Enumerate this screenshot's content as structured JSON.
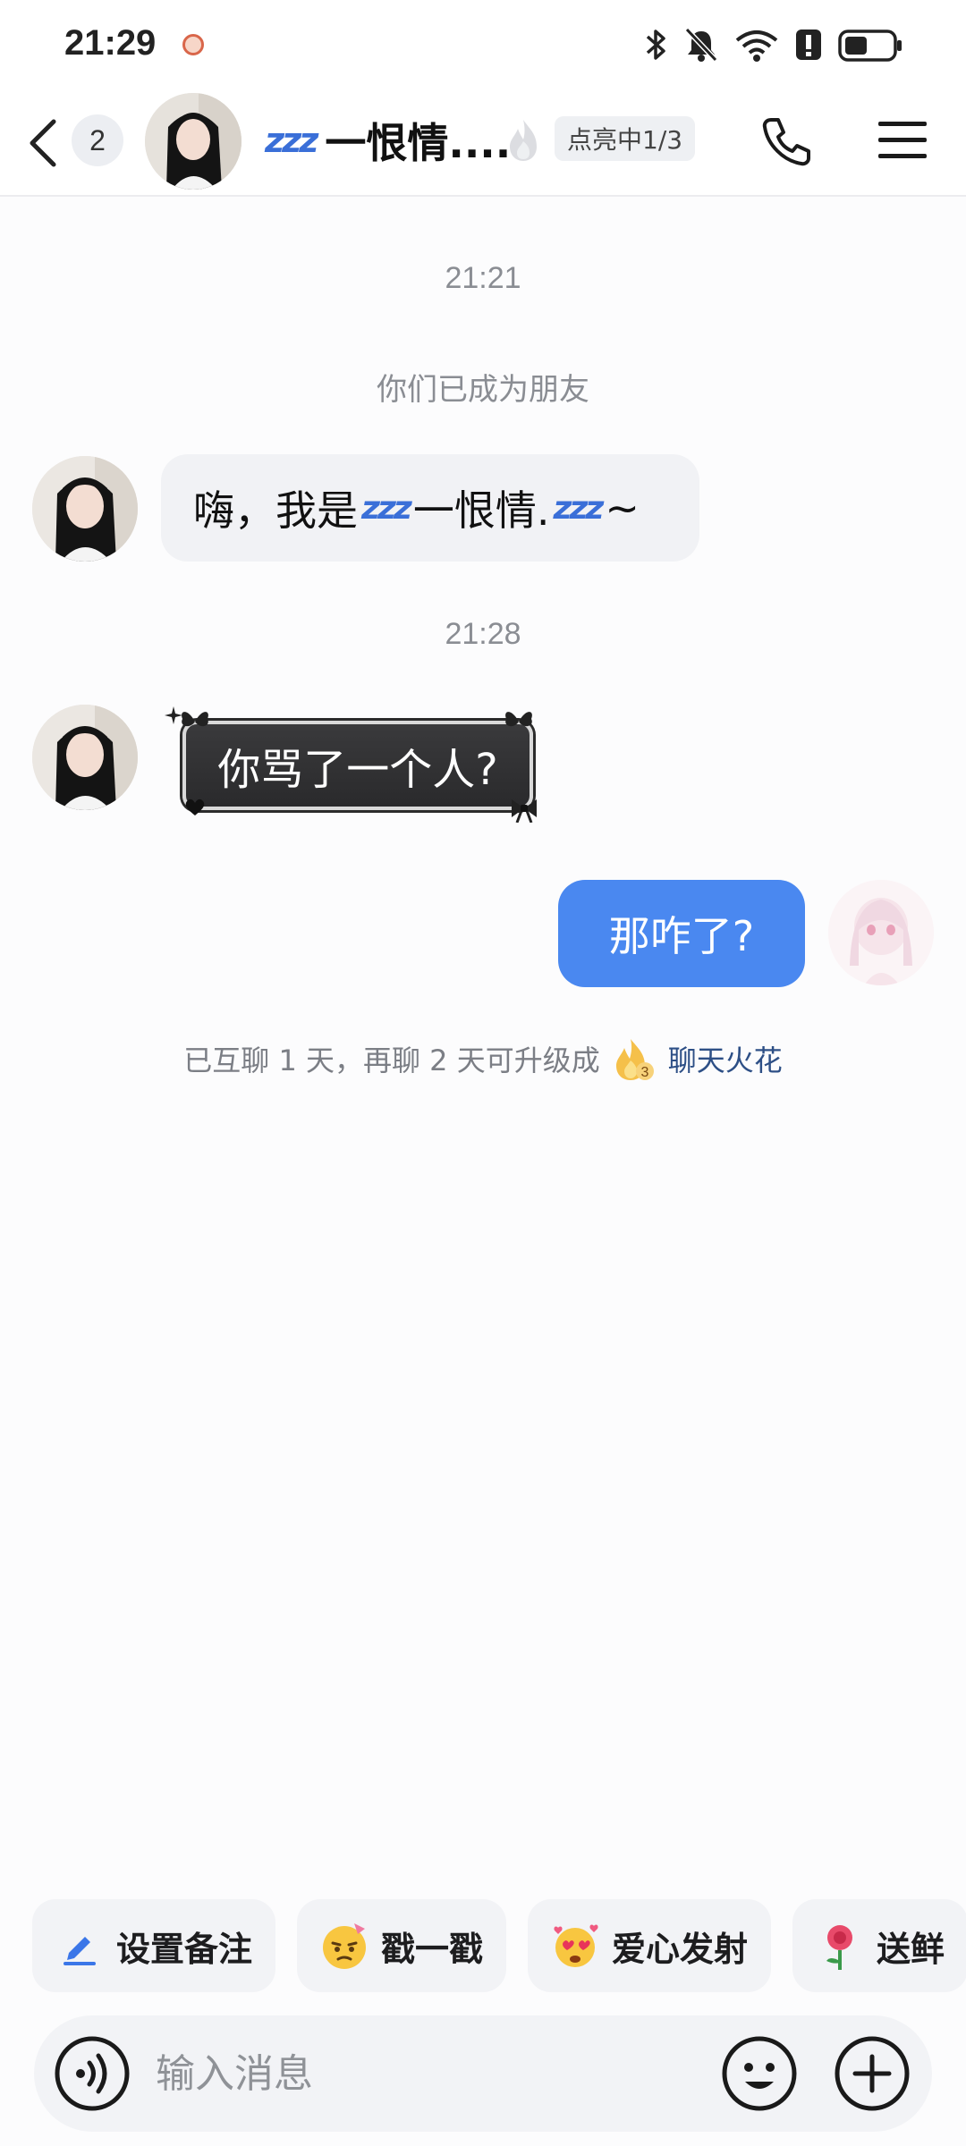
{
  "status_bar": {
    "time": "21:29",
    "icons": [
      "bluetooth-icon",
      "bell-muted-icon",
      "wifi-icon",
      "alert-icon",
      "battery-icon"
    ]
  },
  "header": {
    "unread_count": "2",
    "title_decoration": "zzz",
    "title": "一恨情....",
    "light_status": "点亮中1/3",
    "icons": [
      "back-arrow-icon",
      "phone-icon",
      "menu-icon",
      "flame-icon"
    ]
  },
  "messages": {
    "time_1": "21:21",
    "system_friends": "你们已成为朋友",
    "msg_1_prefix": "嗨，我是",
    "msg_1_deco_a": "zzz",
    "msg_1_name": "一恨情.",
    "msg_1_deco_b": "zzz",
    "msg_1_suffix": "~",
    "time_2": "21:28",
    "msg_2": "你骂了一个人?",
    "msg_3": "那咋了?",
    "spark_text": "已互聊 1 天，再聊 2 天可升级成",
    "spark_badge": "3",
    "spark_link": "聊天火花"
  },
  "quick_actions": [
    {
      "label": "设置备注",
      "icon": "pencil-icon"
    },
    {
      "label": "戳一戳",
      "icon": "poke-emoji-icon"
    },
    {
      "label": "爱心发射",
      "icon": "heart-eyes-emoji-icon"
    },
    {
      "label": "送鲜",
      "icon": "rose-icon"
    }
  ],
  "input_bar": {
    "placeholder": "输入消息",
    "icons": [
      "voice-icon",
      "emoji-icon",
      "plus-icon"
    ]
  },
  "colors": {
    "accent_blue": "#4a88f0",
    "background": "#fcfcfd",
    "chip_bg": "#f2f3f6",
    "zzz_blue": "#3a6fd8"
  }
}
